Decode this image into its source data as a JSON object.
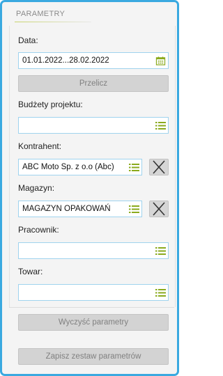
{
  "panel": {
    "title": "PARAMETRY"
  },
  "date": {
    "label": "Data:",
    "value": "01.01.2022...28.02.2022",
    "icon": "calendar-icon"
  },
  "recalc_button": "Przelicz",
  "budgets": {
    "label": "Budżety projektu:",
    "value": "",
    "icon": "list-icon"
  },
  "contractor": {
    "label": "Kontrahent:",
    "value": "ABC Moto Sp. z o.o (Abc)",
    "icon": "list-icon",
    "clear_icon": "close-icon"
  },
  "warehouse": {
    "label": "Magazyn:",
    "value": "MAGAZYN OPAKOWAŃ",
    "icon": "list-icon",
    "clear_icon": "close-icon"
  },
  "employee": {
    "label": "Pracownik:",
    "value": "",
    "icon": "list-icon"
  },
  "product": {
    "label": "Towar:",
    "value": "",
    "icon": "list-icon"
  },
  "clear_button": "Wyczyść parametry",
  "save_button": "Zapisz zestaw parametrów",
  "colors": {
    "accent_border": "#3aa9e0",
    "icon_green": "#8aaa1c",
    "field_border": "#9fd3ee"
  }
}
